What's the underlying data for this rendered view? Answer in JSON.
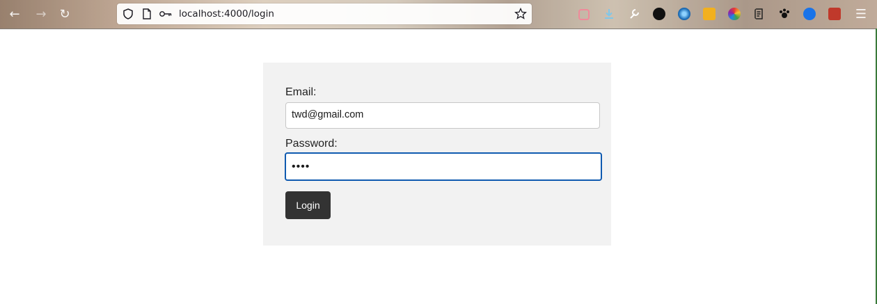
{
  "browser": {
    "url": "localhost:4000/login",
    "nav": {
      "back_glyph": "←",
      "forward_glyph": "→",
      "reload_glyph": "↻",
      "menu_glyph": "☰"
    },
    "extensions": [
      {
        "icon": "pocket-icon",
        "color": "#ef4056"
      },
      {
        "icon": "download-icon",
        "color": "#3aa7d9"
      },
      {
        "icon": "wrench-icon",
        "color": "#ffffff"
      },
      {
        "icon": "twd-extension-icon",
        "color": "#111111"
      },
      {
        "icon": "globe-extension-icon",
        "color": "#1e6fb8"
      },
      {
        "icon": "yellow-extension-icon",
        "color": "#f2b01e"
      },
      {
        "icon": "color-wheel-icon",
        "color": "#6ac04a"
      },
      {
        "icon": "notes-icon",
        "color": "#222222"
      },
      {
        "icon": "paw-icon",
        "color": "#111111"
      },
      {
        "icon": "play-extension-icon",
        "color": "#1a73e8"
      },
      {
        "icon": "red-extension-icon",
        "color": "#c0392b"
      }
    ]
  },
  "form": {
    "email_label": "Email:",
    "email_value": "twd@gmail.com",
    "password_label": "Password:",
    "password_value": "••••",
    "login_label": "Login"
  },
  "colors": {
    "card_bg": "#f2f2f2",
    "button_bg": "#333333",
    "focus_ring": "#0f5ab0"
  }
}
